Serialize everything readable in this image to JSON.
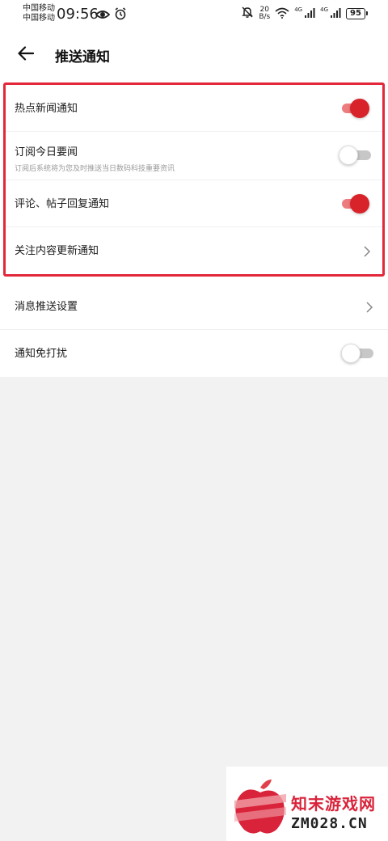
{
  "status_bar": {
    "carrier_1": "中国移动",
    "carrier_2": "中国移动",
    "time": "09:56",
    "net_speed_value": "20",
    "net_speed_unit": "B/s",
    "signal_label_1": "4G",
    "signal_label_2": "4G",
    "battery": "95"
  },
  "header": {
    "title": "推送通知"
  },
  "highlighted_group": [
    {
      "label": "热点新闻通知",
      "desc": "",
      "control": "toggle",
      "on": true
    },
    {
      "label": "订阅今日要闻",
      "desc": "订阅后系统将为您及时推送当日数码科技重要资讯",
      "control": "toggle",
      "on": false
    },
    {
      "label": "评论、帖子回复通知",
      "desc": "",
      "control": "toggle",
      "on": true
    },
    {
      "label": "关注内容更新通知",
      "desc": "",
      "control": "chevron",
      "on": null
    }
  ],
  "other_rows": [
    {
      "label": "消息推送设置",
      "control": "chevron"
    },
    {
      "label": "通知免打扰",
      "control": "toggle",
      "on": false
    }
  ],
  "watermark": {
    "name": "知末游戏网",
    "url": "ZM028.CN"
  },
  "colors": {
    "accent": "#d8232a",
    "highlight_border": "#e2283a",
    "background": "#f2f2f2"
  }
}
